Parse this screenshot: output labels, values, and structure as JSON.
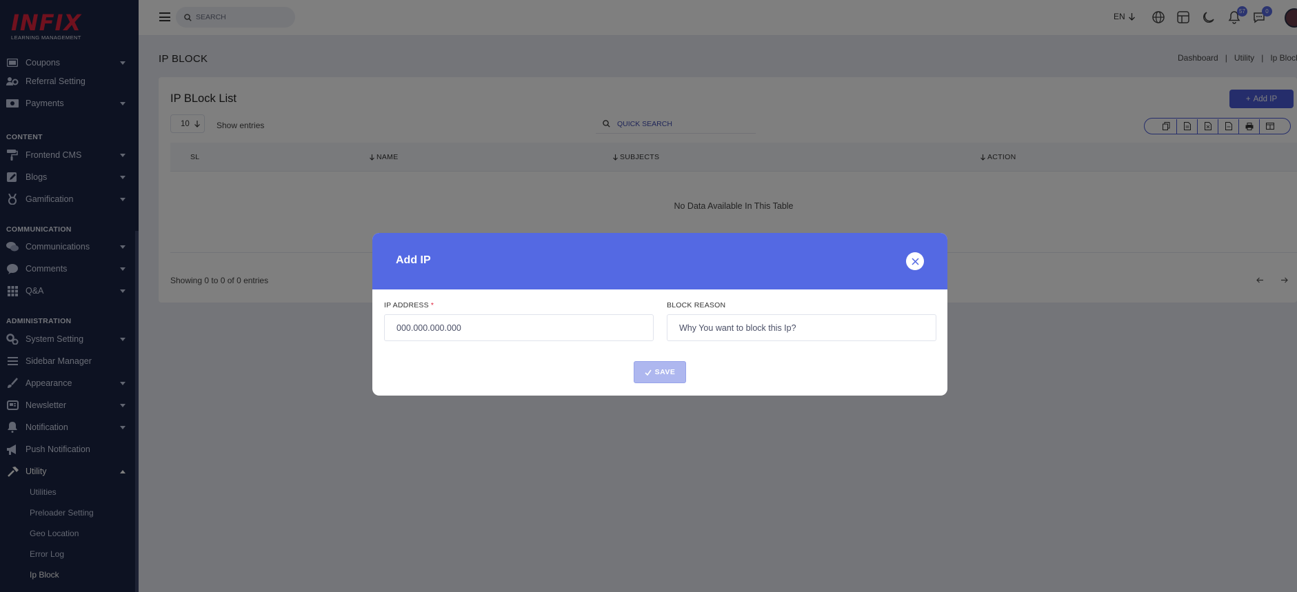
{
  "brand": {
    "logo_text": "INFIX",
    "logo_subtitle": "LEARNING MANAGEMENT"
  },
  "sidebar": {
    "items": [
      {
        "label": "Coupons",
        "icon": "ticket-icon",
        "chevron": "down"
      },
      {
        "label": "Referral Setting",
        "icon": "users-gear-icon",
        "chevron": "none"
      },
      {
        "label": "Payments",
        "icon": "money-icon",
        "chevron": "down"
      }
    ],
    "section_content": "CONTENT",
    "content_items": [
      {
        "label": "Frontend CMS",
        "icon": "paint-roller-icon"
      },
      {
        "label": "Blogs",
        "icon": "edit-icon"
      },
      {
        "label": "Gamification",
        "icon": "medal-icon"
      }
    ],
    "section_communication": "COMMUNICATION",
    "communication_items": [
      {
        "label": "Communications",
        "icon": "chat-bubbles-icon"
      },
      {
        "label": "Comments",
        "icon": "comment-icon"
      },
      {
        "label": "Q&A",
        "icon": "grid-icon"
      }
    ],
    "section_administration": "ADMINISTRATION",
    "admin_items": [
      {
        "label": "System Setting",
        "icon": "gears-icon",
        "chevron": "down"
      },
      {
        "label": "Sidebar Manager",
        "icon": "list-icon",
        "chevron": "none"
      },
      {
        "label": "Appearance",
        "icon": "brush-icon",
        "chevron": "down"
      },
      {
        "label": "Newsletter",
        "icon": "newspaper-icon",
        "chevron": "down"
      },
      {
        "label": "Notification",
        "icon": "bell-icon",
        "chevron": "down"
      },
      {
        "label": "Push Notification",
        "icon": "megaphone-icon",
        "chevron": "none"
      },
      {
        "label": "Utility",
        "icon": "hammer-icon",
        "chevron": "up"
      }
    ],
    "utility_sub": [
      "Utilities",
      "Preloader Setting",
      "Geo Location",
      "Error Log",
      "Ip Block"
    ]
  },
  "topbar": {
    "search_placeholder": "SEARCH",
    "language": "EN",
    "notification_count": "57",
    "message_count": "0"
  },
  "page": {
    "title": "IP BLOCK",
    "breadcrumb": [
      "Dashboard",
      "Utility",
      "Ip Block"
    ]
  },
  "card": {
    "title": "IP BLock List",
    "add_button": "Add IP",
    "entries_value": "10",
    "entries_label": "Show entries",
    "quick_search_placeholder": "QUICK SEARCH",
    "export_buttons": [
      "copy-icon",
      "csv-icon",
      "excel-icon",
      "pdf-icon",
      "print-icon",
      "columns-icon"
    ],
    "columns": [
      "SL",
      "NAME",
      "SUBJECTS",
      "ACTION"
    ],
    "empty_text": "No Data Available In This Table",
    "showing_text": "Showing 0 to 0 of 0 entries"
  },
  "modal": {
    "title": "Add IP",
    "ip_label": "IP ADDRESS",
    "ip_required": "*",
    "ip_placeholder": "000.000.000.000",
    "reason_label": "BLOCK REASON",
    "reason_placeholder": "Why You want to block this Ip?",
    "save_label": "SAVE"
  },
  "colors": {
    "sidebar_bg": "#1b2544",
    "accent": "#5469e3",
    "logo_red": "#e0233c"
  }
}
